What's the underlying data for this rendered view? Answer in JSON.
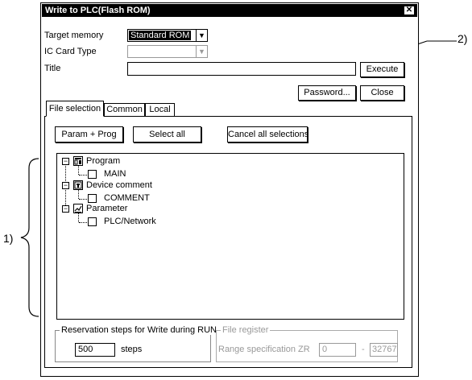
{
  "window": {
    "title": "Write to PLC(Flash ROM)",
    "close_glyph": "✕"
  },
  "form": {
    "target_memory_label": "Target memory",
    "target_memory_value": "Standard ROM",
    "ic_card_type_label": "IC Card Type",
    "ic_card_type_value": "",
    "title_label": "Title",
    "title_value": ""
  },
  "buttons": {
    "execute": "Execute",
    "password": "Password...",
    "close": "Close",
    "param_prog": "Param + Prog",
    "select_all": "Select all",
    "cancel_all": "Cancel all selections"
  },
  "tabs": [
    {
      "label": "File selection",
      "active": true
    },
    {
      "label": "Common",
      "active": false
    },
    {
      "label": "Local",
      "active": false
    }
  ],
  "tree": [
    {
      "label": "Program",
      "icon": "program-icon",
      "children": [
        {
          "label": "MAIN",
          "checked": false
        }
      ]
    },
    {
      "label": "Device comment",
      "icon": "device-comment-icon",
      "children": [
        {
          "label": "COMMENT",
          "checked": false
        }
      ]
    },
    {
      "label": "Parameter",
      "icon": "parameter-icon",
      "children": [
        {
          "label": "PLC/Network",
          "checked": false
        }
      ]
    }
  ],
  "reservation": {
    "group_label": "Reservation steps for Write during RUN",
    "steps_value": "500",
    "steps_unit": "steps"
  },
  "file_register": {
    "group_label": "File register",
    "range_label": "Range specification ZR",
    "from_value": "0",
    "separator": "-",
    "to_value": "32767"
  },
  "annotations": {
    "callout_1": "1)",
    "callout_2": "2)"
  }
}
